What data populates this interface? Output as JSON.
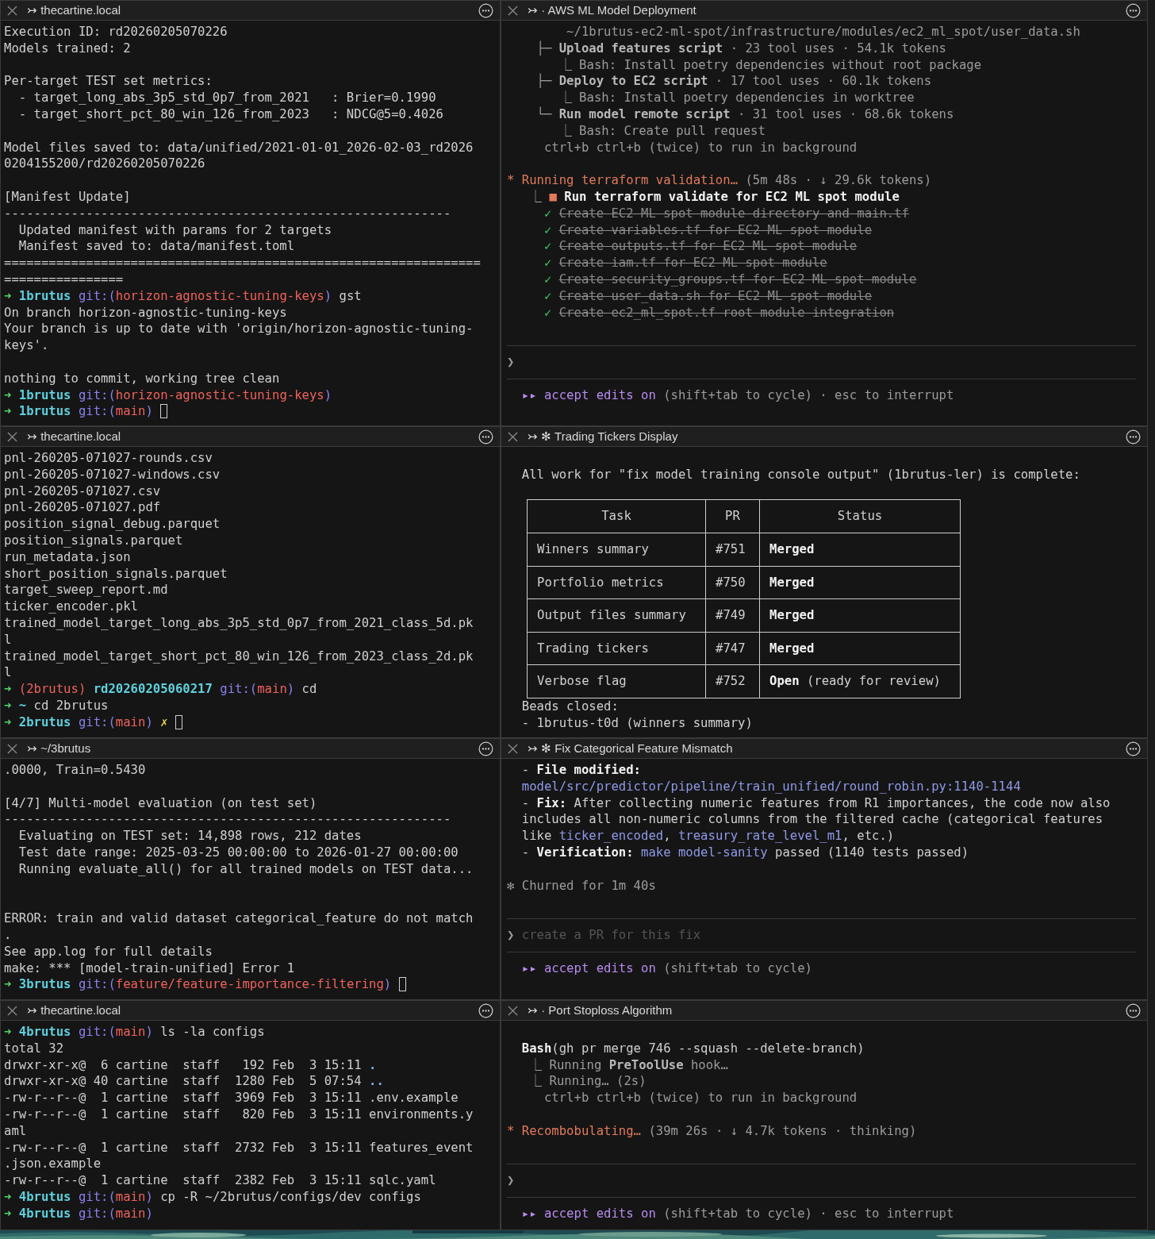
{
  "panes": [
    {
      "prefix": "↣",
      "title": "thecartine.local",
      "blocks": [
        {
          "kind": "line",
          "text": "Execution ID: rd20260205070226"
        },
        {
          "kind": "line",
          "text": "Models trained: 2"
        },
        {
          "kind": "blank"
        },
        {
          "kind": "line",
          "text": "Per-target TEST set metrics:"
        },
        {
          "kind": "line",
          "text": "  - target_long_abs_3p5_std_0p7_from_2021   : Brier=0.1990"
        },
        {
          "kind": "line",
          "text": "  - target_short_pct_80_win_126_from_2023   : NDCG@5=0.4026"
        },
        {
          "kind": "blank"
        },
        {
          "kind": "line",
          "text": "Model files saved to: data/unified/2021-01-01_2026-02-03_rd2026"
        },
        {
          "kind": "line",
          "text": "0204155200/rd20260205070226"
        },
        {
          "kind": "blank"
        },
        {
          "kind": "line",
          "text": "[Manifest Update]"
        },
        {
          "kind": "line",
          "text": "------------------------------------------------------------"
        },
        {
          "kind": "line",
          "text": "  Updated manifest with params for 2 targets"
        },
        {
          "kind": "line",
          "text": "  Manifest saved to: data/manifest.toml"
        },
        {
          "kind": "line",
          "text": "================================================================"
        },
        {
          "kind": "line",
          "text": "================"
        },
        {
          "kind": "line",
          "segs": [
            {
              "t": "➜ ",
              "kind": "arrow"
            },
            {
              "t": "1brutus ",
              "kind": "directory"
            },
            {
              "t": "git:(",
              "kind": "git"
            },
            {
              "t": "horizon-agnostic-tuning-keys",
              "kind": "branch"
            },
            {
              "t": ") ",
              "kind": "git"
            },
            {
              "t": "gst",
              "kind": "text"
            }
          ]
        },
        {
          "kind": "line",
          "text": "On branch horizon-agnostic-tuning-keys"
        },
        {
          "kind": "line",
          "text": "Your branch is up to date with 'origin/horizon-agnostic-tuning-"
        },
        {
          "kind": "line",
          "text": "keys'."
        },
        {
          "kind": "blank"
        },
        {
          "kind": "line",
          "text": "nothing to commit, working tree clean"
        },
        {
          "kind": "line",
          "segs": [
            {
              "t": "➜ ",
              "kind": "arrow"
            },
            {
              "t": "1brutus ",
              "kind": "directory"
            },
            {
              "t": "git:(",
              "kind": "git"
            },
            {
              "t": "horizon-agnostic-tuning-keys",
              "kind": "branch"
            },
            {
              "t": ")",
              "kind": "git"
            }
          ]
        },
        {
          "kind": "line",
          "segs": [
            {
              "t": "➜ ",
              "kind": "arrow"
            },
            {
              "t": "1brutus ",
              "kind": "directory"
            },
            {
              "t": "git:(",
              "kind": "git"
            },
            {
              "t": "main",
              "kind": "branch"
            },
            {
              "t": ") ",
              "kind": "git"
            },
            {
              "kind": "cursor"
            }
          ]
        }
      ]
    },
    {
      "prefix": "↣ ·",
      "title": "AWS ML Model Deployment",
      "blocks": [
        {
          "kind": "note",
          "text": "        ~/1brutus-ec2-ml-spot/infrastructure/modules/ec2_ml_spot/user_data.sh"
        },
        {
          "kind": "line",
          "segs": [
            {
              "t": "    ├─ ",
              "kind": "note"
            },
            {
              "t": "Upload features script",
              "kind": "label"
            },
            {
              "t": " · 23 tool uses · 54.1k tokens",
              "kind": "note"
            }
          ]
        },
        {
          "kind": "note",
          "text": "       ⎿ Bash: Install poetry dependencies without root package"
        },
        {
          "kind": "line",
          "segs": [
            {
              "t": "    ├─ ",
              "kind": "note"
            },
            {
              "t": "Deploy to EC2 script",
              "kind": "label"
            },
            {
              "t": " · 17 tool uses · 60.1k tokens",
              "kind": "note"
            }
          ]
        },
        {
          "kind": "note",
          "text": "       ⎿ Bash: Install poetry dependencies in worktree"
        },
        {
          "kind": "line",
          "segs": [
            {
              "t": "    └─ ",
              "kind": "note"
            },
            {
              "t": "Run model remote script",
              "kind": "label"
            },
            {
              "t": " · 31 tool uses · 68.6k tokens",
              "kind": "note"
            }
          ]
        },
        {
          "kind": "note",
          "text": "       ⎿ Bash: Create pull request"
        },
        {
          "kind": "note",
          "text": "     ctrl+b ctrl+b (twice) to run in background"
        },
        {
          "kind": "blank"
        },
        {
          "kind": "line",
          "segs": [
            {
              "t": "* Running terraform validation…",
              "kind": "activity"
            },
            {
              "t": " (5m 48s · ↓ 29.6k tokens)",
              "kind": "note"
            }
          ]
        },
        {
          "kind": "line",
          "segs": [
            {
              "t": "   ⎿ ",
              "kind": "note"
            },
            {
              "t": "■ ",
              "kind": "activity"
            },
            {
              "t": "Run terraform validate for EC2 ML spot module",
              "kind": "emphasis"
            }
          ]
        },
        {
          "kind": "line",
          "segs": [
            {
              "t": "     ✓ ",
              "kind": "check"
            },
            {
              "t": "Create EC2 ML spot module directory and main.tf",
              "kind": "done"
            }
          ]
        },
        {
          "kind": "line",
          "segs": [
            {
              "t": "     ✓ ",
              "kind": "check"
            },
            {
              "t": "Create variables.tf for EC2 ML spot module",
              "kind": "done"
            }
          ]
        },
        {
          "kind": "line",
          "segs": [
            {
              "t": "     ✓ ",
              "kind": "check"
            },
            {
              "t": "Create outputs.tf for EC2 ML spot module",
              "kind": "done"
            }
          ]
        },
        {
          "kind": "line",
          "segs": [
            {
              "t": "     ✓ ",
              "kind": "check"
            },
            {
              "t": "Create iam.tf for EC2 ML spot module",
              "kind": "done"
            }
          ]
        },
        {
          "kind": "line",
          "segs": [
            {
              "t": "     ✓ ",
              "kind": "check"
            },
            {
              "t": "Create security_groups.tf for EC2 ML spot module",
              "kind": "done"
            }
          ]
        },
        {
          "kind": "line",
          "segs": [
            {
              "t": "     ✓ ",
              "kind": "check"
            },
            {
              "t": "Create user_data.sh for EC2 ML spot module",
              "kind": "done"
            }
          ]
        },
        {
          "kind": "line",
          "segs": [
            {
              "t": "     ✓ ",
              "kind": "check"
            },
            {
              "t": "Create ec2_ml_spot.tf root module integration",
              "kind": "done"
            }
          ]
        },
        {
          "kind": "blank"
        },
        {
          "kind": "rule"
        },
        {
          "kind": "input",
          "prompt": "❯"
        },
        {
          "kind": "rule"
        },
        {
          "kind": "line",
          "segs": [
            {
              "t": "  ▸▸ accept edits on",
              "kind": "mode"
            },
            {
              "t": " (shift+tab to cycle) · esc to interrupt",
              "kind": "note"
            }
          ]
        }
      ]
    },
    {
      "prefix": "↣",
      "title": "thecartine.local",
      "blocks": [
        {
          "kind": "line",
          "text": "pnl-260205-071027-rounds.csv"
        },
        {
          "kind": "line",
          "text": "pnl-260205-071027-windows.csv"
        },
        {
          "kind": "line",
          "text": "pnl-260205-071027.csv"
        },
        {
          "kind": "line",
          "text": "pnl-260205-071027.pdf"
        },
        {
          "kind": "line",
          "text": "position_signal_debug.parquet"
        },
        {
          "kind": "line",
          "text": "position_signals.parquet"
        },
        {
          "kind": "line",
          "text": "run_metadata.json"
        },
        {
          "kind": "line",
          "text": "short_position_signals.parquet"
        },
        {
          "kind": "line",
          "text": "target_sweep_report.md"
        },
        {
          "kind": "line",
          "text": "ticker_encoder.pkl"
        },
        {
          "kind": "line",
          "text": "trained_model_target_long_abs_3p5_std_0p7_from_2021_class_5d.pk"
        },
        {
          "kind": "line",
          "text": "l"
        },
        {
          "kind": "line",
          "text": "trained_model_target_short_pct_80_win_126_from_2023_class_2d.pk"
        },
        {
          "kind": "line",
          "text": "l"
        },
        {
          "kind": "line",
          "segs": [
            {
              "t": "➜ ",
              "kind": "arrow"
            },
            {
              "t": "(2brutus) ",
              "kind": "branch"
            },
            {
              "t": "rd20260205060217 ",
              "kind": "directory"
            },
            {
              "t": "git:(",
              "kind": "git"
            },
            {
              "t": "main",
              "kind": "branch"
            },
            {
              "t": ") ",
              "kind": "git"
            },
            {
              "t": "cd",
              "kind": "text"
            }
          ]
        },
        {
          "kind": "line",
          "segs": [
            {
              "t": "➜ ",
              "kind": "arrow"
            },
            {
              "t": "~ ",
              "kind": "directory"
            },
            {
              "t": "cd 2brutus",
              "kind": "text"
            }
          ]
        },
        {
          "kind": "line",
          "segs": [
            {
              "t": "➜ ",
              "kind": "arrow"
            },
            {
              "t": "2brutus ",
              "kind": "directory"
            },
            {
              "t": "git:(",
              "kind": "git"
            },
            {
              "t": "main",
              "kind": "branch"
            },
            {
              "t": ") ",
              "kind": "git"
            },
            {
              "t": "✗ ",
              "kind": "dirty"
            },
            {
              "kind": "cursor"
            }
          ]
        }
      ]
    },
    {
      "prefix": "↣ ✻",
      "title": "Trading Tickers Display",
      "blocks": [
        {
          "kind": "blank"
        },
        {
          "kind": "line",
          "text": "  All work for \"fix model training console output\" (1brutus-ler) is complete:"
        },
        {
          "kind": "blank"
        },
        {
          "kind": "table",
          "columns": [
            "Task",
            "PR",
            "Status"
          ],
          "rows": [
            {
              "task": "Winners summary",
              "pr": "#751",
              "status": {
                "label": "Merged"
              }
            },
            {
              "task": "Portfolio metrics",
              "pr": "#750",
              "status": {
                "label": "Merged"
              }
            },
            {
              "task": "Output files summary",
              "pr": "#749",
              "status": {
                "label": "Merged"
              }
            },
            {
              "task": "Trading tickers",
              "pr": "#747",
              "status": {
                "label": "Merged"
              }
            },
            {
              "task": "Verbose flag",
              "pr": "#752",
              "status": {
                "label": "Open",
                "note": "(ready for review)"
              }
            }
          ]
        },
        {
          "kind": "line",
          "text": "  Beads closed:"
        },
        {
          "kind": "line",
          "text": "  - 1brutus-t0d (winners summary)"
        }
      ]
    },
    {
      "prefix": "↣",
      "title": "~/3brutus",
      "blocks": [
        {
          "kind": "line",
          "text": ".0000, Train=0.5430"
        },
        {
          "kind": "blank"
        },
        {
          "kind": "line",
          "text": "[4/7] Multi-model evaluation (on test set)"
        },
        {
          "kind": "line",
          "text": "------------------------------------------------------------"
        },
        {
          "kind": "line",
          "text": "  Evaluating on TEST set: 14,898 rows, 212 dates"
        },
        {
          "kind": "line",
          "text": "  Test date range: 2025-03-25 00:00:00 to 2026-01-27 00:00:00"
        },
        {
          "kind": "line",
          "text": "  Running evaluate_all() for all trained models on TEST data..."
        },
        {
          "kind": "blank"
        },
        {
          "kind": "blank"
        },
        {
          "kind": "line",
          "text": "ERROR: train and valid dataset categorical_feature do not match"
        },
        {
          "kind": "line",
          "text": "."
        },
        {
          "kind": "line",
          "text": "See app.log for full details"
        },
        {
          "kind": "line",
          "text": "make: *** [model-train-unified] Error 1"
        },
        {
          "kind": "line",
          "segs": [
            {
              "t": "➜ ",
              "kind": "arrow"
            },
            {
              "t": "3brutus ",
              "kind": "directory"
            },
            {
              "t": "git:(",
              "kind": "git"
            },
            {
              "t": "feature/feature-importance-filtering",
              "kind": "branch"
            },
            {
              "t": ") ",
              "kind": "git"
            },
            {
              "kind": "cursor"
            }
          ]
        }
      ]
    },
    {
      "prefix": "↣ ✻",
      "title": "Fix Categorical Feature Mismatch",
      "blocks": [
        {
          "kind": "line",
          "segs": [
            {
              "t": "  - ",
              "kind": "text"
            },
            {
              "t": "File modified:",
              "kind": "emphasis"
            }
          ]
        },
        {
          "kind": "line",
          "segs": [
            {
              "t": "  model/src/predictor/pipeline/train_unified/round_robin.py:1140-1144",
              "kind": "path"
            }
          ]
        },
        {
          "kind": "line",
          "segs": [
            {
              "t": "  - ",
              "kind": "text"
            },
            {
              "t": "Fix:",
              "kind": "emphasis"
            },
            {
              "t": " After collecting numeric features from R1 importances, the code now also",
              "kind": "text"
            }
          ]
        },
        {
          "kind": "line",
          "text": "  includes all non-numeric columns from the filtered cache (categorical features"
        },
        {
          "kind": "line",
          "segs": [
            {
              "t": "  like ",
              "kind": "text"
            },
            {
              "t": "ticker_encoded",
              "kind": "path"
            },
            {
              "t": ", ",
              "kind": "text"
            },
            {
              "t": "treasury_rate_level_m1",
              "kind": "path"
            },
            {
              "t": ", etc.)",
              "kind": "text"
            }
          ]
        },
        {
          "kind": "line",
          "segs": [
            {
              "t": "  - ",
              "kind": "text"
            },
            {
              "t": "Verification:",
              "kind": "emphasis"
            },
            {
              "t": " make model-sanity",
              "kind": "path"
            },
            {
              "t": " passed (1140 tests passed)",
              "kind": "text"
            }
          ]
        },
        {
          "kind": "blank"
        },
        {
          "kind": "note",
          "text": "✻ Churned for 1m 40s"
        },
        {
          "kind": "blank"
        },
        {
          "kind": "rule"
        },
        {
          "kind": "input",
          "prompt": "❯",
          "placeholder": "create a PR for this fix"
        },
        {
          "kind": "rule"
        },
        {
          "kind": "line",
          "segs": [
            {
              "t": "  ▸▸ accept edits on",
              "kind": "mode"
            },
            {
              "t": " (shift+tab to cycle)",
              "kind": "note"
            }
          ]
        }
      ]
    },
    {
      "prefix": "↣",
      "title": "thecartine.local",
      "blocks": [
        {
          "kind": "line",
          "segs": [
            {
              "t": "➜ ",
              "kind": "arrow"
            },
            {
              "t": "4brutus ",
              "kind": "directory"
            },
            {
              "t": "git:(",
              "kind": "git"
            },
            {
              "t": "main",
              "kind": "branch"
            },
            {
              "t": ") ",
              "kind": "git"
            },
            {
              "t": "ls -la configs",
              "kind": "text"
            }
          ]
        },
        {
          "kind": "line",
          "text": "total 32"
        },
        {
          "kind": "line",
          "segs": [
            {
              "t": "drwxr-xr-x@  6 cartine  staff   192 Feb  3 15:11 ",
              "kind": "text"
            },
            {
              "t": ".",
              "kind": "entry"
            }
          ]
        },
        {
          "kind": "line",
          "segs": [
            {
              "t": "drwxr-xr-x@ 40 cartine  staff  1280 Feb  5 07:54 ",
              "kind": "text"
            },
            {
              "t": "..",
              "kind": "entry"
            }
          ]
        },
        {
          "kind": "line",
          "text": "-rw-r--r--@  1 cartine  staff  3969 Feb  3 15:11 .env.example"
        },
        {
          "kind": "line",
          "text": "-rw-r--r--@  1 cartine  staff   820 Feb  3 15:11 environments.y"
        },
        {
          "kind": "line",
          "text": "aml"
        },
        {
          "kind": "line",
          "text": "-rw-r--r--@  1 cartine  staff  2732 Feb  3 15:11 features_event"
        },
        {
          "kind": "line",
          "text": ".json.example"
        },
        {
          "kind": "line",
          "text": "-rw-r--r--@  1 cartine  staff  2382 Feb  3 15:11 sqlc.yaml"
        },
        {
          "kind": "line",
          "segs": [
            {
              "t": "➜ ",
              "kind": "arrow"
            },
            {
              "t": "4brutus ",
              "kind": "directory"
            },
            {
              "t": "git:(",
              "kind": "git"
            },
            {
              "t": "main",
              "kind": "branch"
            },
            {
              "t": ") ",
              "kind": "git"
            },
            {
              "t": "cp -R ~/2brutus/configs/dev configs",
              "kind": "text"
            }
          ]
        },
        {
          "kind": "line",
          "segs": [
            {
              "t": "➜ ",
              "kind": "arrow"
            },
            {
              "t": "4brutus ",
              "kind": "directory"
            },
            {
              "t": "git:(",
              "kind": "git"
            },
            {
              "t": "main",
              "kind": "branch"
            },
            {
              "t": ")",
              "kind": "git"
            }
          ]
        }
      ]
    },
    {
      "prefix": "↣ ·",
      "title": "Port Stoploss Algorithm",
      "blocks": [
        {
          "kind": "blank"
        },
        {
          "kind": "line",
          "segs": [
            {
              "t": "  Bash",
              "kind": "emphasis"
            },
            {
              "t": "(gh pr merge 746 --squash --delete-branch)",
              "kind": "text"
            }
          ]
        },
        {
          "kind": "line",
          "segs": [
            {
              "t": "   ⎿ Running ",
              "kind": "note"
            },
            {
              "t": "PreToolUse",
              "kind": "label"
            },
            {
              "t": " hook…",
              "kind": "note"
            }
          ]
        },
        {
          "kind": "note",
          "text": "   ⎿ Running… (2s)"
        },
        {
          "kind": "note",
          "text": "     ctrl+b ctrl+b (twice) to run in background"
        },
        {
          "kind": "blank"
        },
        {
          "kind": "line",
          "segs": [
            {
              "t": "* Recombobulating…",
              "kind": "activity"
            },
            {
              "t": " (39m 26s · ↓ 4.7k tokens · thinking)",
              "kind": "note"
            }
          ]
        },
        {
          "kind": "blank"
        },
        {
          "kind": "rule"
        },
        {
          "kind": "input",
          "prompt": "❯"
        },
        {
          "kind": "rule"
        },
        {
          "kind": "line",
          "segs": [
            {
              "t": "  ▸▸ accept edits on",
              "kind": "mode"
            },
            {
              "t": " (shift+tab to cycle) · esc to interrupt",
              "kind": "note"
            }
          ]
        }
      ]
    }
  ]
}
